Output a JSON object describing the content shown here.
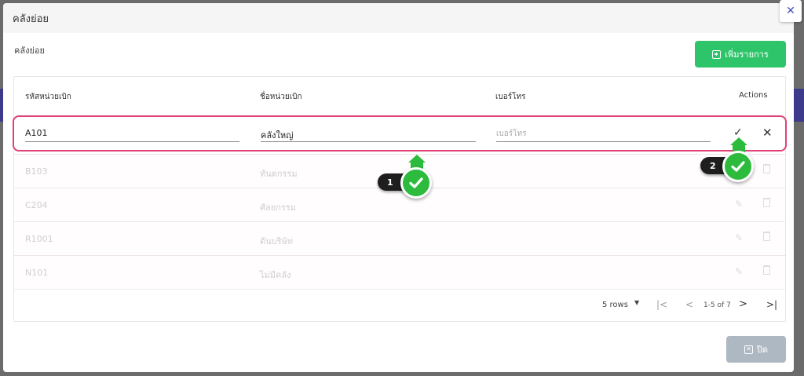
{
  "dialog": {
    "title": "คลังย่อย",
    "section_label": "คลังย่อย",
    "add_button_label": "เพิ่มรายการ",
    "close_button_label": "ปิด",
    "close_x": "✕"
  },
  "table": {
    "headers": {
      "code": "รหัสหน่วยเบิก",
      "name": "ชื่อหน่วยเบิก",
      "phone": "เบอร์โทร",
      "actions": "Actions"
    },
    "edit_row": {
      "code_value": "A101",
      "name_value": "คลังใหญ่",
      "phone_placeholder": "เบอร์โทร"
    },
    "rows": [
      {
        "code": "B103",
        "name": "ทันตกรรม"
      },
      {
        "code": "C204",
        "name": "ศัลยกรรม"
      },
      {
        "code": "R1001",
        "name": "ต้นบริษัท"
      },
      {
        "code": "N101",
        "name": "ไม่มีคลัง"
      }
    ]
  },
  "pagination": {
    "rows_per_page": "5 rows",
    "info": "1-5 of 7"
  },
  "callouts": {
    "step1": "1",
    "step2": "2"
  },
  "icons": {
    "save": "check-icon",
    "cancel": "close-icon",
    "edit": "pencil-icon",
    "delete": "trash-icon"
  },
  "colors": {
    "accent_green": "#2ec56a",
    "highlight_pink": "#e0407a",
    "close_btn": "#aeb8c2"
  }
}
